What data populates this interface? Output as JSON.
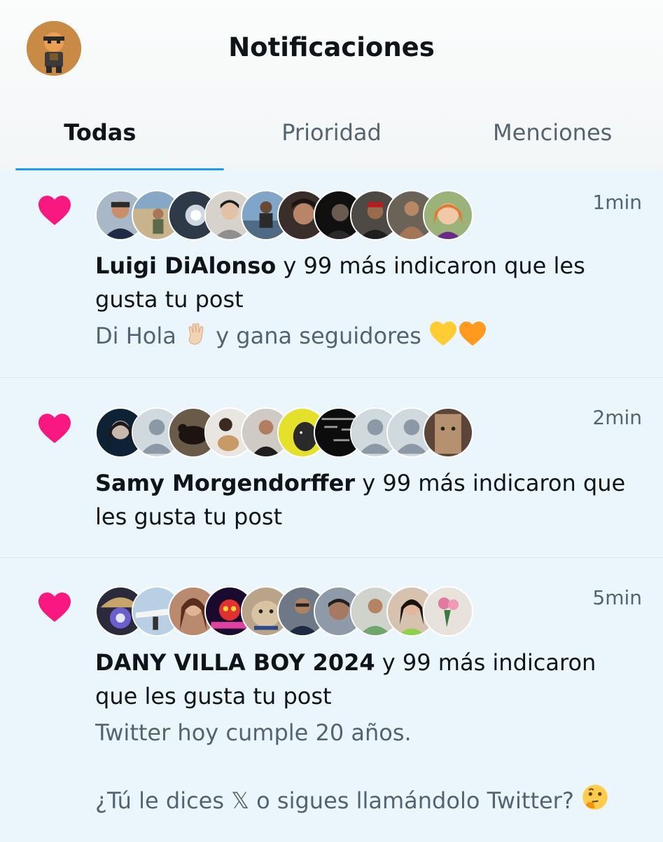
{
  "header": {
    "title": "Notificaciones",
    "avatar_icon": "profile-avatar"
  },
  "tabs": [
    {
      "label": "Todas",
      "active": true
    },
    {
      "label": "Prioridad",
      "active": false
    },
    {
      "label": "Menciones",
      "active": false
    }
  ],
  "notifications": [
    {
      "icon": "heart-icon",
      "time": "1min",
      "user": "Luigi DiAlonso",
      "action": " y 99 más indicaron que les gusta tu post",
      "post_text": "Di Hola",
      "post_text_2": " y gana seguidores",
      "avatar_count": 10
    },
    {
      "icon": "heart-icon",
      "time": "2min",
      "user": "Samy Morgendorffer",
      "action": " y 99 más indicaron que les gusta tu post",
      "avatar_count": 10
    },
    {
      "icon": "heart-icon",
      "time": "5min",
      "user": "DANY VILLA BOY 2024",
      "action": " y 99 más indicaron que les gusta tu post",
      "post_text": "Twitter hoy cumple 20 años.",
      "post_text_2": "¿Tú le dices 𝕏 o sigues llamándolo Twitter?",
      "avatar_count": 10
    }
  ],
  "colors": {
    "heart": "#f91880",
    "accent": "#1d9bf0",
    "secondary_text": "#536471",
    "unread_bg": "#ebf6fc"
  }
}
